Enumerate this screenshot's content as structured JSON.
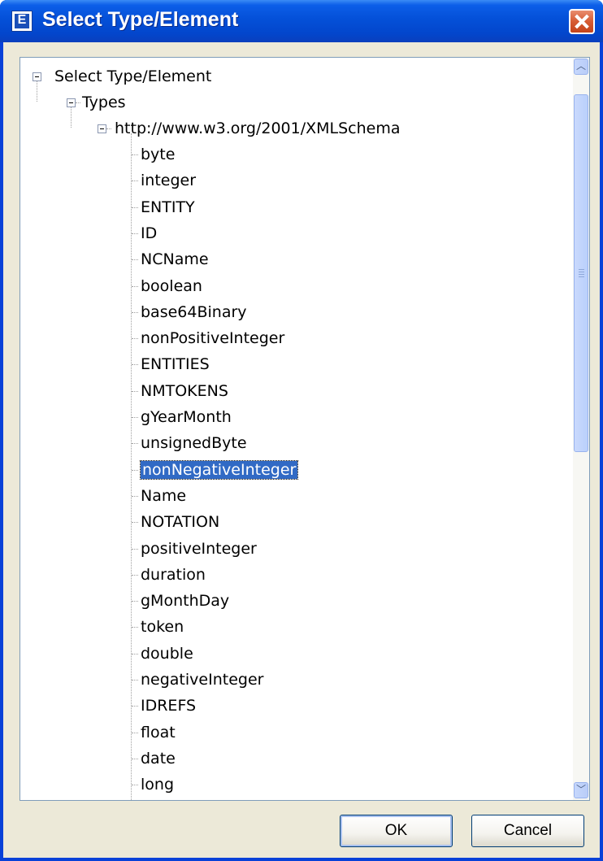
{
  "window": {
    "title": "Select Type/Element",
    "icon": "app-icon",
    "icon_letter": "E"
  },
  "tree": {
    "root_label": "Select Type/Element",
    "types_label": "Types",
    "namespace_label": "http://www.w3.org/2001/XMLSchema",
    "items": [
      "byte",
      "integer",
      "ENTITY",
      "ID",
      "NCName",
      "boolean",
      "base64Binary",
      "nonPositiveInteger",
      "ENTITIES",
      "NMTOKENS",
      "gYearMonth",
      "unsignedByte",
      "nonNegativeInteger",
      "Name",
      "NOTATION",
      "positiveInteger",
      "duration",
      "gMonthDay",
      "token",
      "double",
      "negativeInteger",
      "IDREFS",
      "float",
      "date",
      "long"
    ],
    "selected_item": "nonNegativeInteger"
  },
  "scrollbar": {
    "up_icon": "chevron-up-icon",
    "down_icon": "chevron-down-icon"
  },
  "buttons": {
    "ok_label": "OK",
    "cancel_label": "Cancel"
  },
  "colors": {
    "titlebar": "#0450d8",
    "selection": "#316ac5",
    "dialog_bg": "#ece9d8",
    "close": "#d65b33"
  }
}
